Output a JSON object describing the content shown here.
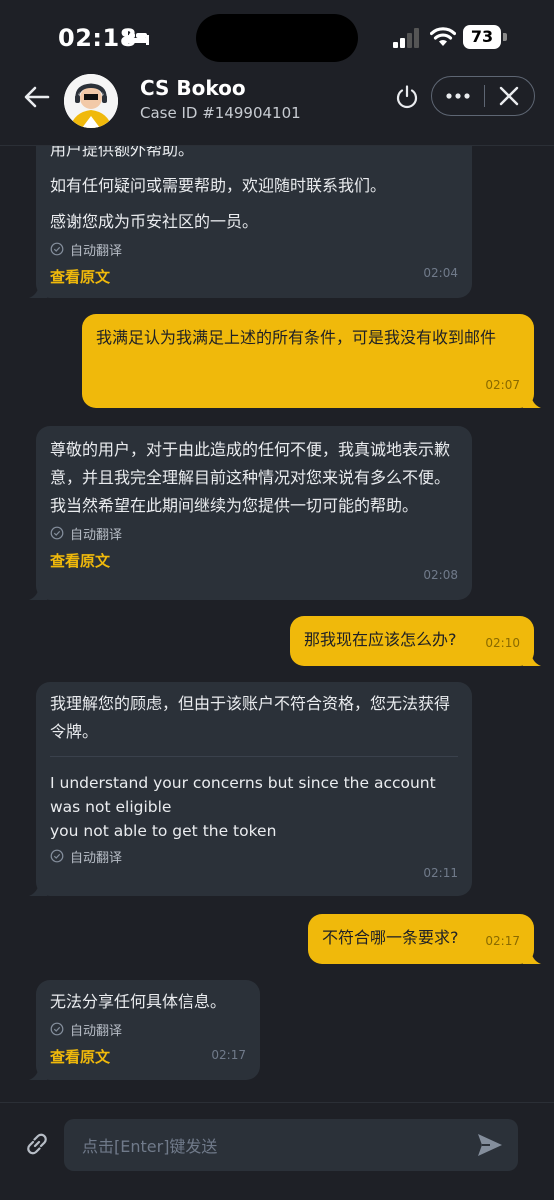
{
  "status_bar": {
    "time": "02:18",
    "battery": "73"
  },
  "header": {
    "agent_name": "CS Bokoo",
    "case_id": "Case ID #149904101"
  },
  "messages": [
    {
      "direction": "in",
      "lines": [
        "用户提供额外帮助。",
        "如有任何疑问或需要帮助，欢迎随时联系我们。",
        "感谢您成为币安社区的一员。"
      ],
      "auto_translate": "自动翻译",
      "view_original": "查看原文",
      "time": "02:04"
    },
    {
      "direction": "out",
      "text": "我满足认为我满足上述的所有条件，可是我没有收到邮件",
      "time": "02:07"
    },
    {
      "direction": "in",
      "text": "尊敬的用户，对于由此造成的任何不便，我真诚地表示歉意，并且我完全理解目前这种情况对您来说有多么不便。我当然希望在此期间继续为您提供一切可能的帮助。",
      "auto_translate": "自动翻译",
      "view_original": "查看原文",
      "time": "02:08"
    },
    {
      "direction": "out",
      "text": "那我现在应该怎么办?",
      "time": "02:10"
    },
    {
      "direction": "in",
      "text": "我理解您的顾虑，但由于该账户不符合资格，您无法获得令牌。",
      "original": "I understand  your concerns but since the account was not  eligible\nyou not able to get the  token",
      "auto_translate": "自动翻译",
      "time": "02:11"
    },
    {
      "direction": "out",
      "text": "不符合哪一条要求?",
      "time": "02:17"
    },
    {
      "direction": "in",
      "text": "无法分享任何具体信息。",
      "auto_translate": "自动翻译",
      "view_original": "查看原文",
      "time": "02:17"
    }
  ],
  "input": {
    "placeholder": "点击[Enter]键发送"
  },
  "colors": {
    "background": "#1e2026",
    "incoming_bubble": "#2b3139",
    "outgoing_bubble": "#f0b90b",
    "accent": "#f0b90b"
  },
  "icons": [
    "back-arrow-icon",
    "power-icon",
    "more-icon",
    "close-icon",
    "check-circle-icon",
    "attach-link-icon",
    "send-icon"
  ]
}
